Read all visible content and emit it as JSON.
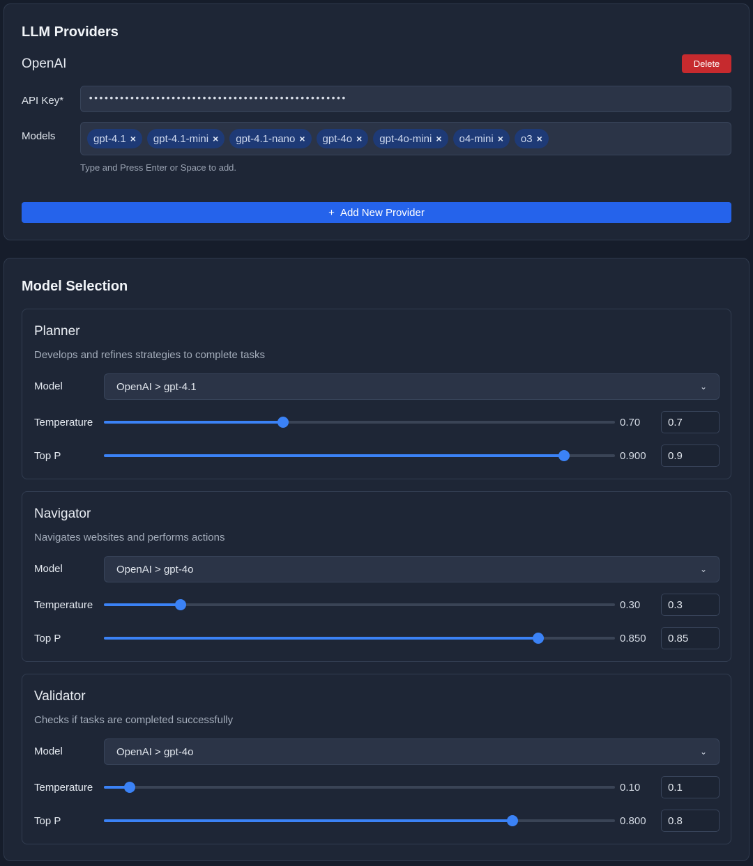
{
  "providers": {
    "title": "LLM Providers",
    "provider_name": "OpenAI",
    "delete_label": "Delete",
    "api_key_label": "API Key*",
    "api_key_value": "••••••••••••••••••••••••••••••••••••••••••••••••••",
    "models_label": "Models",
    "models": [
      "gpt-4.1",
      "gpt-4.1-mini",
      "gpt-4.1-nano",
      "gpt-4o",
      "gpt-4o-mini",
      "o4-mini",
      "o3"
    ],
    "chip_remove": "×",
    "hint": "Type and Press Enter or Space to add.",
    "add_icon": "+",
    "add_label": "Add New Provider"
  },
  "selection": {
    "title": "Model Selection",
    "model_label": "Model",
    "temperature_label": "Temperature",
    "top_p_label": "Top P",
    "chevron": "⌄",
    "agents": [
      {
        "name": "Planner",
        "description": "Develops and refines strategies to complete tasks",
        "model": "OpenAI > gpt-4.1",
        "temperature": {
          "display": "0.70",
          "input": "0.7",
          "fraction": 0.35
        },
        "top_p": {
          "display": "0.900",
          "input": "0.9",
          "fraction": 0.9
        }
      },
      {
        "name": "Navigator",
        "description": "Navigates websites and performs actions",
        "model": "OpenAI > gpt-4o",
        "temperature": {
          "display": "0.30",
          "input": "0.3",
          "fraction": 0.15
        },
        "top_p": {
          "display": "0.850",
          "input": "0.85",
          "fraction": 0.85
        }
      },
      {
        "name": "Validator",
        "description": "Checks if tasks are completed successfully",
        "model": "OpenAI > gpt-4o",
        "temperature": {
          "display": "0.10",
          "input": "0.1",
          "fraction": 0.05
        },
        "top_p": {
          "display": "0.800",
          "input": "0.8",
          "fraction": 0.8
        }
      }
    ]
  },
  "colors": {
    "background": "#161d2b",
    "panel": "#1e2636",
    "accent": "#3b82f6",
    "danger": "#c62a2e",
    "chip": "#1e3a76"
  }
}
